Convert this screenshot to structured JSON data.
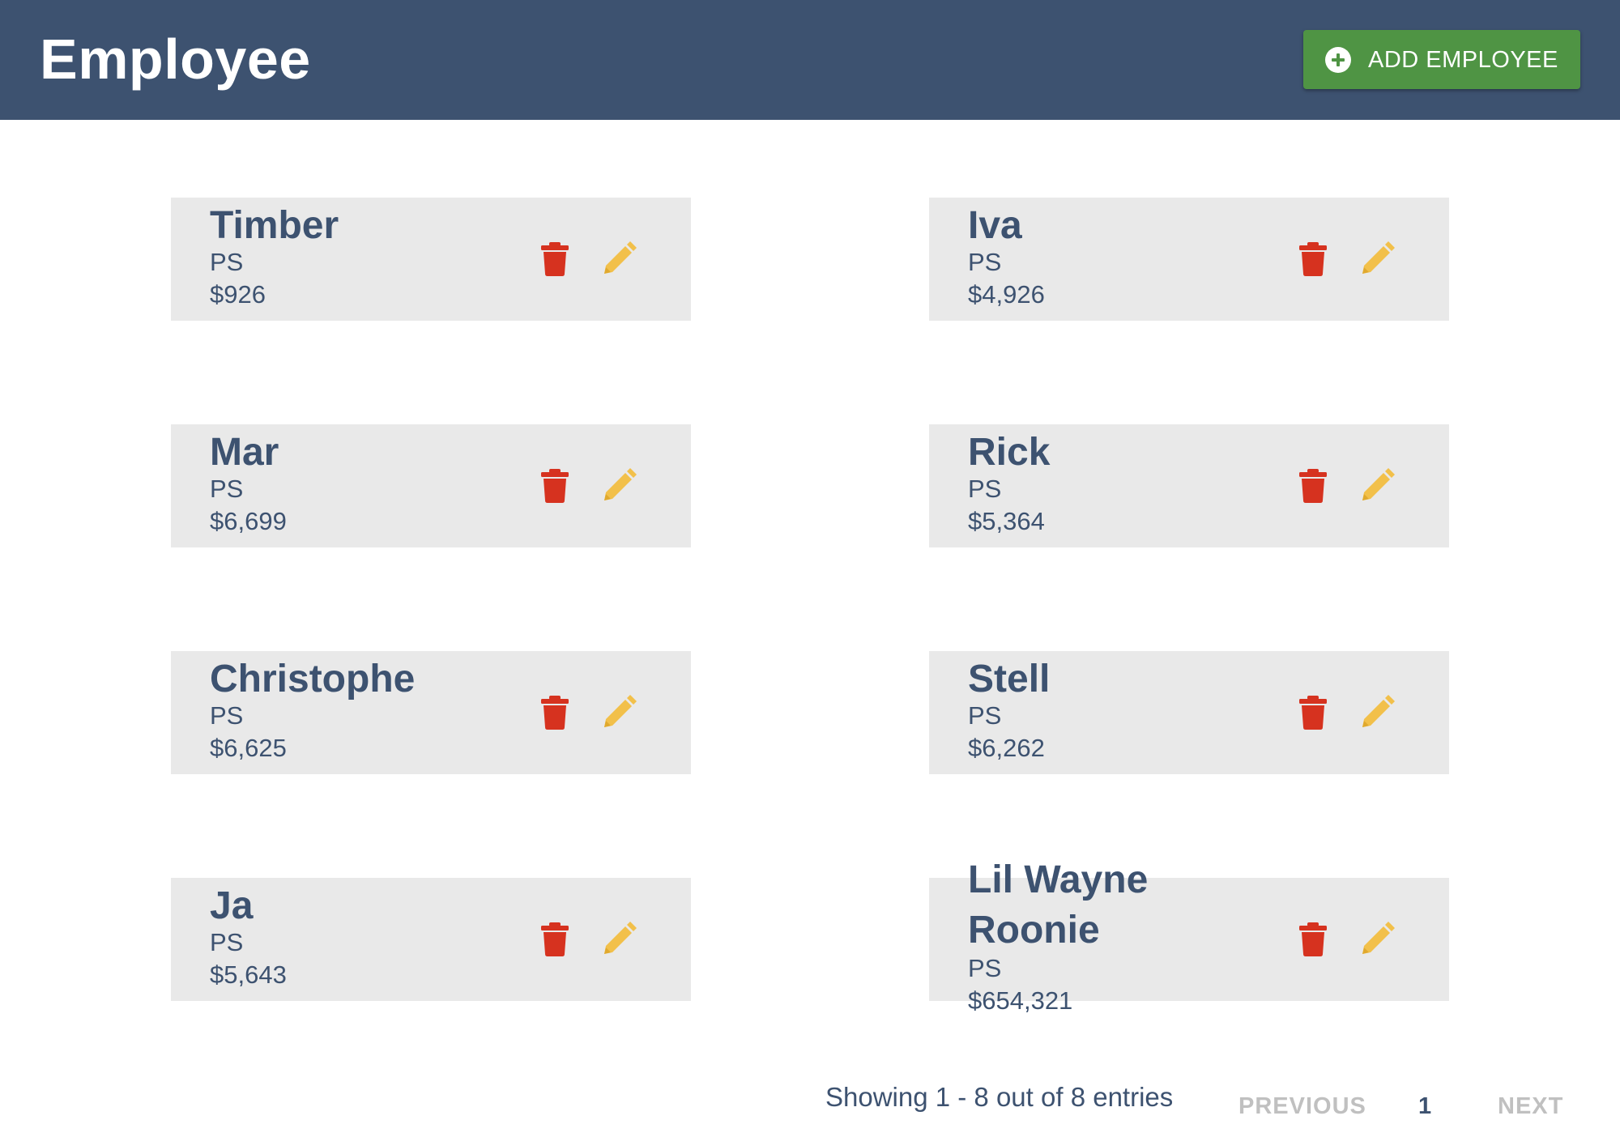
{
  "header": {
    "title": "Employee",
    "add_button_label": "ADD EMPLOYEE",
    "add_button_icon": "plus-circle-icon"
  },
  "colors": {
    "header_bg": "#3d5270",
    "accent_text": "#3d5270",
    "add_button": "#4f9444",
    "card_bg": "#e9e9e9",
    "delete_icon": "#d6321f",
    "edit_icon": "#f2c04a",
    "pager_disabled": "#c0c0c0"
  },
  "employees": [
    {
      "name": "Timber",
      "role": "PS",
      "salary": "$926"
    },
    {
      "name": "Iva",
      "role": "PS",
      "salary": "$4,926"
    },
    {
      "name": "Mar",
      "role": "PS",
      "salary": "$6,699"
    },
    {
      "name": "Rick",
      "role": "PS",
      "salary": "$5,364"
    },
    {
      "name": "Christophe",
      "role": "PS",
      "salary": "$6,625"
    },
    {
      "name": "Stell",
      "role": "PS",
      "salary": "$6,262"
    },
    {
      "name": "Ja",
      "role": "PS",
      "salary": "$5,643"
    },
    {
      "name": "Lil Wayne Roonie",
      "name_lines": [
        "Lil Wayne",
        "Roonie"
      ],
      "role": "PS",
      "salary": "$654,321"
    }
  ],
  "card_icons": {
    "delete": "trash-icon",
    "edit": "pencil-icon"
  },
  "footer": {
    "status": "Showing 1 - 8 out of 8 entries",
    "previous_label": "PREVIOUS",
    "current_page": "1",
    "next_label": "NEXT"
  }
}
